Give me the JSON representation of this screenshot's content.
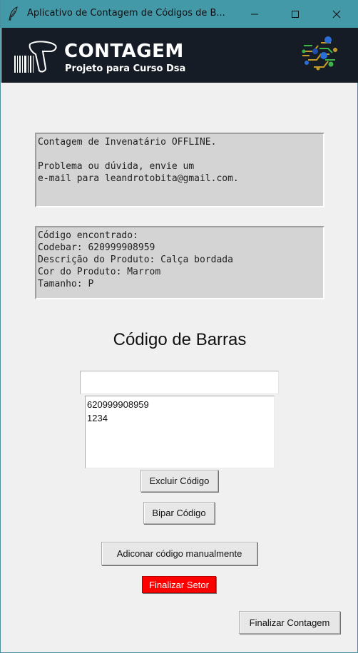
{
  "window": {
    "title": "Aplicativo de Contagem de Códigos de B...",
    "controls": {
      "minimize": "minimize-icon",
      "maximize": "maximize-icon",
      "close": "close-icon"
    }
  },
  "banner": {
    "title": "CONTAGEM",
    "subtitle": "Projeto para Curso Dsa",
    "background": "#161c26"
  },
  "info_box": {
    "text": "Contagem de Invenatário OFFLINE.\n\nProblema ou dúvida, envie um\ne-mail para leandrotobita@gmail.com."
  },
  "result_box": {
    "text": "Código encontrado:\nCodebar: 620999908959\nDescrição do Produto: Calça bordada\nCor do Produto: Marrom\nTamanho: P"
  },
  "barcode_section": {
    "heading": "Código de Barras",
    "input_value": "",
    "codes": [
      "620999908959",
      "1234"
    ]
  },
  "buttons": {
    "delete_code": "Excluir Código",
    "scan_code": "Bipar Código",
    "add_manual": "Adiconar código manualmente",
    "finish_sector": "Finalizar Setor",
    "finish_count": "Finalizar Contagem"
  },
  "colors": {
    "titlebar": "#4499a8",
    "finish_sector_bg": "#ff0000",
    "info_box_bg": "#d4d4d4"
  }
}
